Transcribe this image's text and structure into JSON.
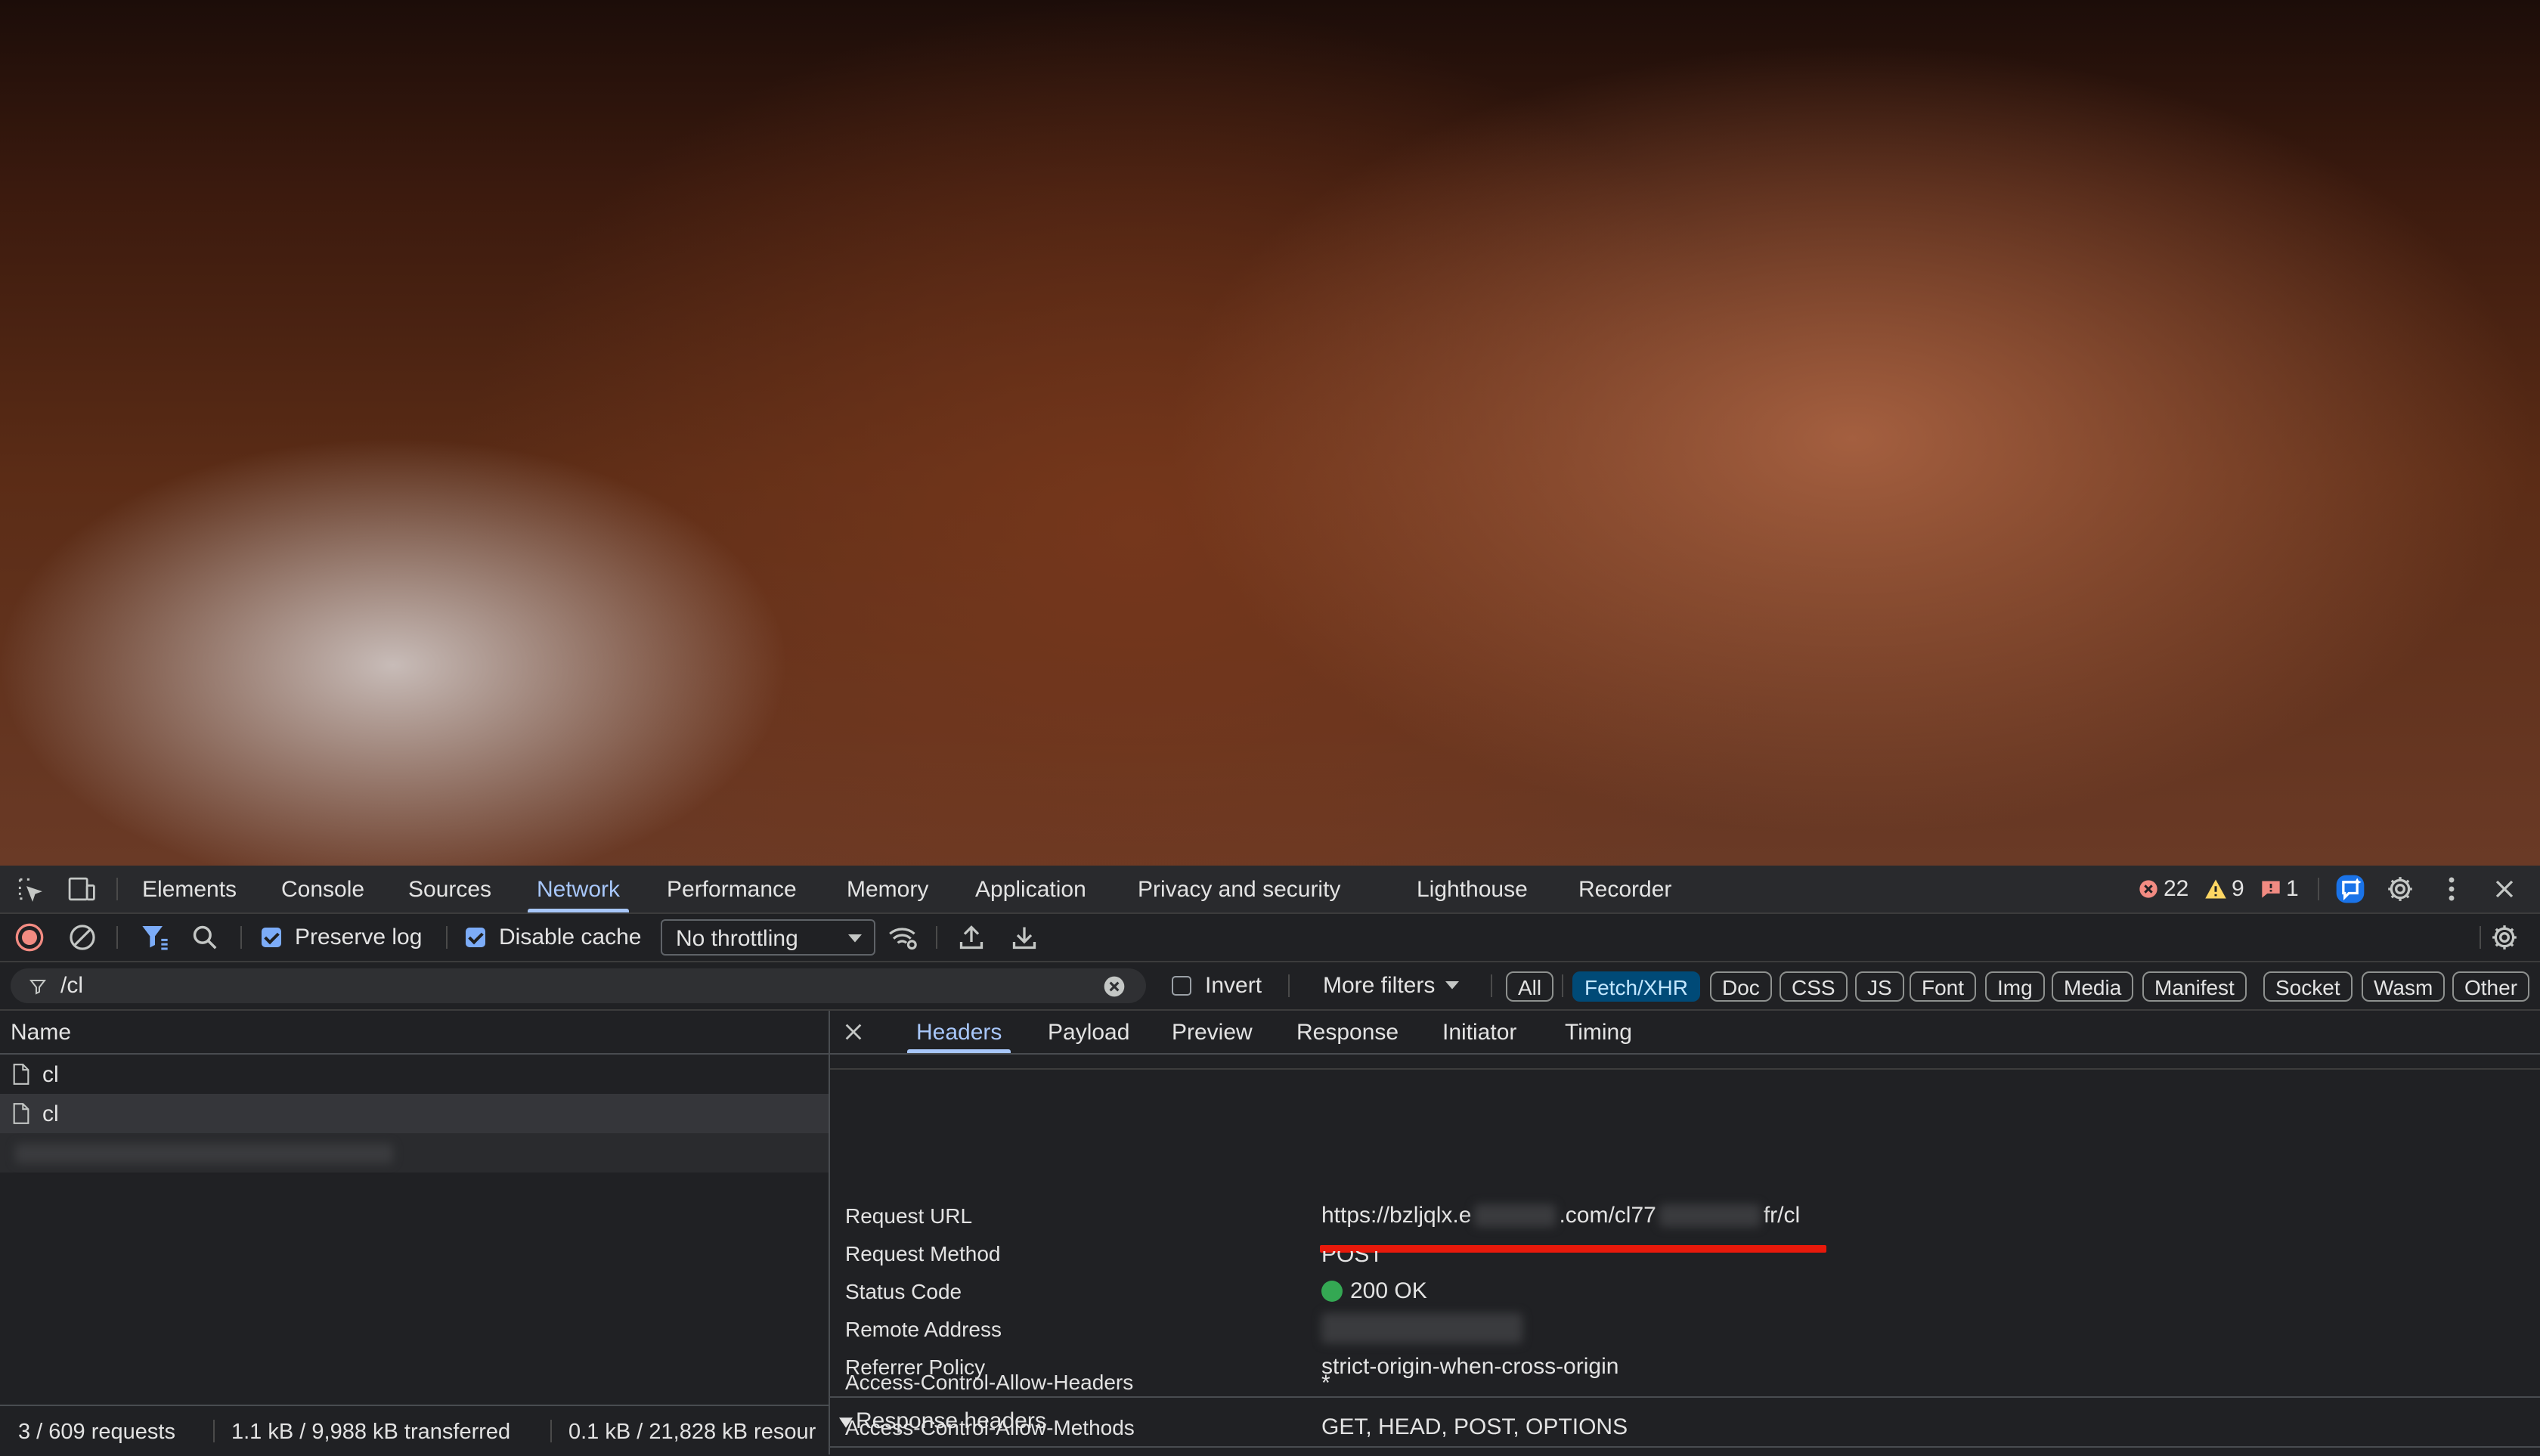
{
  "main_tabs": [
    "Elements",
    "Console",
    "Sources",
    "Network",
    "Performance",
    "Memory",
    "Application",
    "Privacy and security",
    "Lighthouse",
    "Recorder"
  ],
  "status_counts": {
    "errors": "22",
    "warnings": "9",
    "issues": "1"
  },
  "toolbar": {
    "preserve_log": "Preserve log",
    "disable_cache": "Disable cache",
    "throttling": "No throttling"
  },
  "filter": {
    "value": "/cl",
    "invert": "Invert",
    "more_filters": "More filters",
    "types": [
      "All",
      "Fetch/XHR",
      "Doc",
      "CSS",
      "JS",
      "Font",
      "Img",
      "Media",
      "Manifest",
      "Socket",
      "Wasm",
      "Other"
    ]
  },
  "request_list": {
    "column_name": "Name",
    "rows": [
      "cl",
      "cl"
    ]
  },
  "details": {
    "tabs": [
      "Headers",
      "Payload",
      "Preview",
      "Response",
      "Initiator",
      "Timing"
    ],
    "general": {
      "request_url_label": "Request URL",
      "request_url_part1": "https://bzljqlx.e",
      "request_url_part2": ".com/cl77",
      "request_url_part3": "fr/cl",
      "request_method_label": "Request Method",
      "request_method": "POST",
      "status_code_label": "Status Code",
      "status_code": "200 OK",
      "remote_address_label": "Remote Address",
      "referrer_policy_label": "Referrer Policy",
      "referrer_policy": "strict-origin-when-cross-origin"
    },
    "response_headers_title": "Response headers",
    "response_headers": [
      {
        "name": "Access-Control-Allow-Headers",
        "value": "*"
      },
      {
        "name": "Access-Control-Allow-Methods",
        "value": "GET, HEAD, POST, OPTIONS"
      }
    ]
  },
  "footer": {
    "requests": "3 / 609 requests",
    "transferred": "1.1 kB / 9,988 kB transferred",
    "resources": "0.1 kB / 21,828 kB resour"
  },
  "colors": {
    "accent": "#a8c7fa",
    "chip_active": "#004a77",
    "error": "#f28b82",
    "warning": "#fdd663",
    "status_ok": "#34a853",
    "highlight": "#e8190b"
  }
}
